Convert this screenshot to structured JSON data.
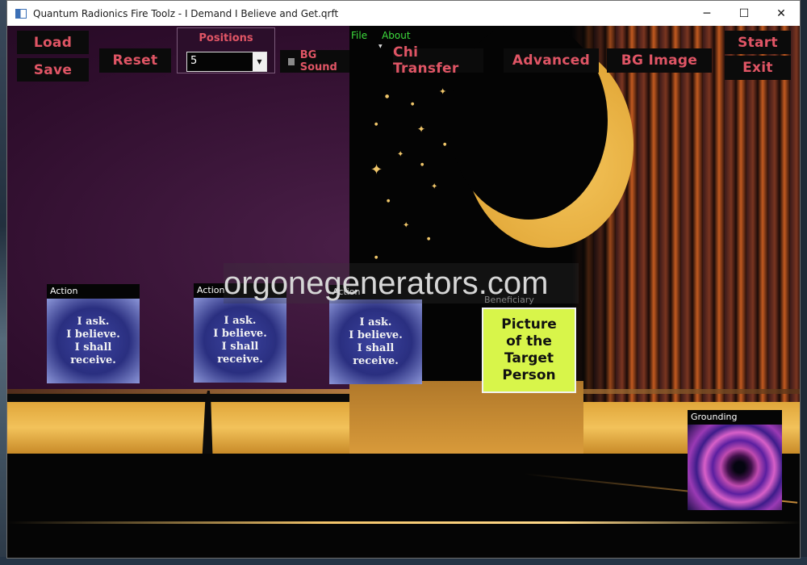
{
  "window": {
    "title": "Quantum Radionics Fire Toolz - I Demand I Believe and Get.qrft",
    "minimize_glyph": "─",
    "maximize_glyph": "☐",
    "close_glyph": "✕"
  },
  "menu": {
    "file": "File",
    "about": "About"
  },
  "toolbar": {
    "load": "Load",
    "save": "Save",
    "reset": "Reset",
    "positions_label": "Positions",
    "positions_value": "5",
    "bg_sound": "BG Sound",
    "bg_sound_checked": false,
    "chi_transfer": "Chi Transfer",
    "advanced": "Advanced",
    "bg_image": "BG Image",
    "start": "Start",
    "exit": "Exit"
  },
  "cards": [
    {
      "label": "Action",
      "lines": [
        "I ask.",
        "I believe.",
        "I shall",
        "receive."
      ]
    },
    {
      "label": "Action",
      "lines": [
        "I ask.",
        "I believe.",
        "I shall",
        "receive."
      ]
    },
    {
      "label": "Action",
      "lines": [
        "I ask.",
        "I believe.",
        "I shall",
        "receive."
      ]
    }
  ],
  "beneficiary": {
    "label": "Beneficiary",
    "lines": [
      "Picture",
      "of the",
      "Target",
      "Person"
    ]
  },
  "grounding": {
    "label": "Grounding"
  },
  "watermark": "orgonegenerators.com",
  "colors": {
    "accent": "#e05565",
    "menu": "#3ddc3d",
    "beneficiary_bg": "#d8f54a"
  }
}
